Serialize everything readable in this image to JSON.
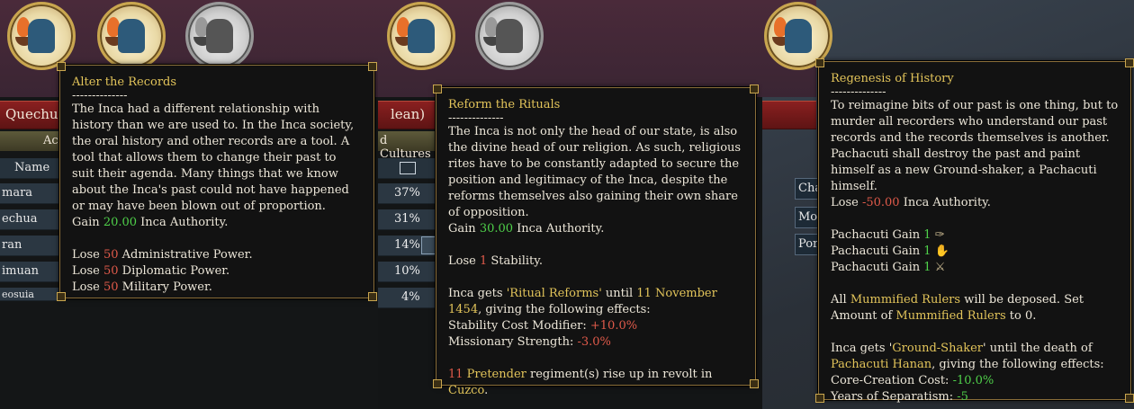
{
  "colors": {
    "gold": "#e2c45a",
    "red": "#e05a4a",
    "green": "#4fd04a",
    "text": "#ece6d8"
  },
  "panel1": {
    "icons": [
      "reform-active-icon",
      "reform-active-icon",
      "reform-locked-icon"
    ],
    "country_banner": "Quechua",
    "tab_label": "Acc",
    "name_header": "Name",
    "rows": [
      "mara",
      "echua",
      "ran",
      "imuan",
      "eosuia"
    ],
    "pcts": [
      "37%",
      "31%",
      "14%",
      "10%",
      "4%"
    ],
    "tooltip": {
      "title": "Alter the Records",
      "sep": "--------------",
      "body": "The Inca had a different relationship with history than we are used to. In the Inca society, the oral history and other records are a tool. A tool that allows them to change their past to suit their agenda. Many things that we know about the Inca's past could not have happened or may have been blown out of proportion.",
      "gain_pre": "Gain ",
      "gain_val": "20.00",
      "gain_post": " Inca Authority.",
      "lose_pre": "Lose ",
      "lose_val": "50",
      "lose_adm": " Administrative Power.",
      "lose_dip": " Diplomatic Power.",
      "lose_mil": " Military Power."
    }
  },
  "panel2": {
    "banner_text": "lean)",
    "tab_label": "d Cultures",
    "tooltip": {
      "title": "Reform the Rituals",
      "sep": "--------------",
      "body": "The Inca is not only the head of our state, is also the divine head of our religion. As such, religious rites have to be constantly adapted to secure the position and legitimacy of the Inca, despite the reforms themselves also gaining their own share of opposition.",
      "gain_pre": "Gain ",
      "gain_val": "30.00",
      "gain_post": " Inca Authority.",
      "lose_pre": "Lose ",
      "lose_val": "1",
      "lose_post": " Stability.",
      "gets_pre": "Inca gets ",
      "gets_mod": "'Ritual Reforms'",
      "gets_mid": " until ",
      "gets_date": "11 November 1454",
      "gets_post": ", giving the following effects:",
      "eff1_label": "Stability Cost Modifier: ",
      "eff1_val": "+10.0%",
      "eff2_label": "Missionary Strength: ",
      "eff2_val": "-3.0%",
      "revolt_num": "11",
      "revolt_type": " Pretender",
      "revolt_mid": " regiment(s) rise up in revolt in ",
      "revolt_loc": "Cuzco",
      "revolt_post": "."
    }
  },
  "panel3": {
    "side_buttons": [
      "Cha",
      "Mo:",
      "Por"
    ],
    "tooltip": {
      "title": "Regenesis of History",
      "sep": "--------------",
      "body": "To reimagine bits of our past is one thing, but to murder all recorders who understand our past records and the records themselves is another. Pachacuti shall destroy the past and paint himself as a new Ground-shaker, a Pachacuti himself.",
      "lose_pre": "Lose ",
      "lose_val": "-50.00",
      "lose_post": " Inca Authority.",
      "gain_line": "Pachacuti Gain ",
      "gain_val": "1",
      "gain_icons": [
        "adm-skill-icon",
        "dip-skill-icon",
        "mil-skill-icon"
      ],
      "all_pre": "All ",
      "all_mod": "Mummified Rulers",
      "all_mid": " will be deposed. Set Amount of ",
      "all_mod2": "Mummified Rulers",
      "all_post": " to 0.",
      "gets_pre": "Inca gets '",
      "gets_mod": "Ground-Shaker",
      "gets_mid": "'  until the death of ",
      "gets_who": "Pachacuti Hanan",
      "gets_post": ", giving the following effects:",
      "eff1_label": "Core-Creation Cost: ",
      "eff1_val": "-10.0%",
      "eff2_label": "Years of Separatism: ",
      "eff2_val": "-5"
    }
  }
}
